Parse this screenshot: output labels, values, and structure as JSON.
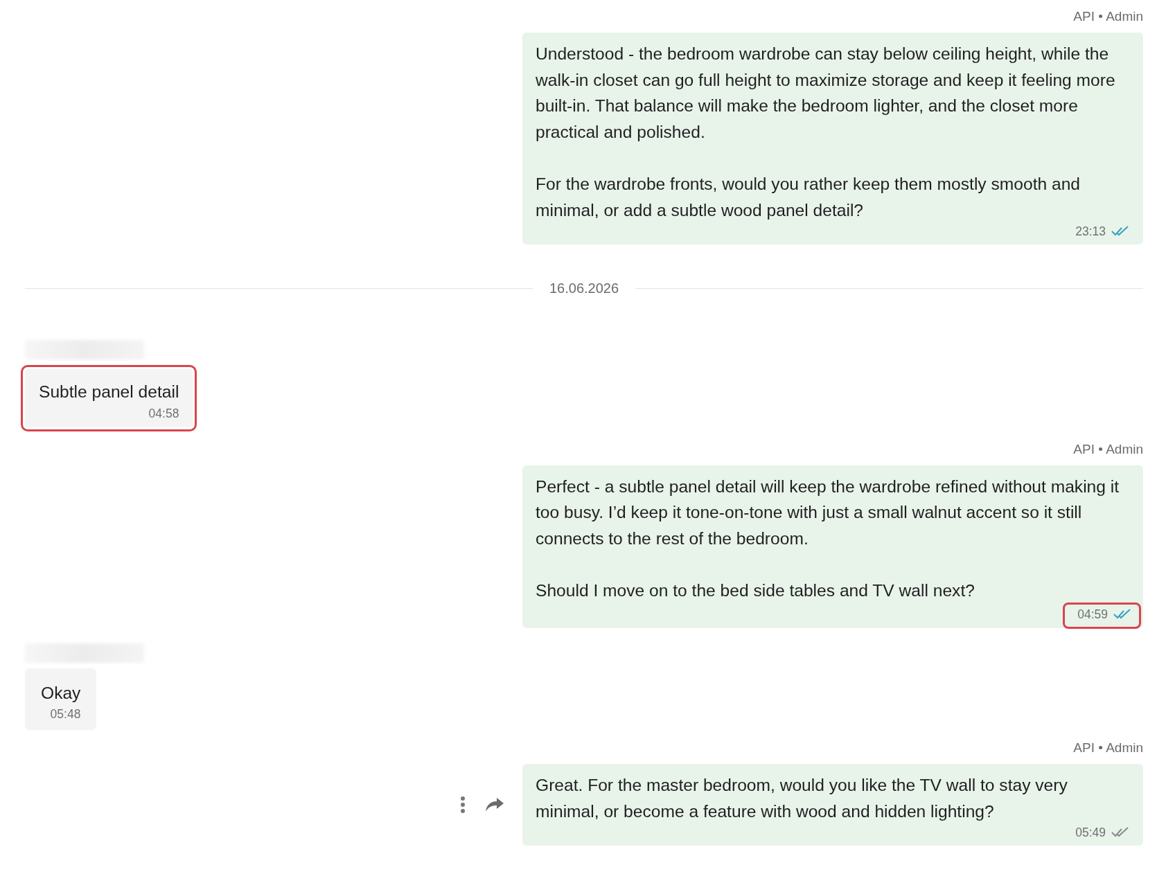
{
  "messages": [
    {
      "kind": "outgoing",
      "sender": "API • Admin",
      "paragraphs": [
        "Understood - the bedroom wardrobe can stay below ceiling height, while the walk-in closet can go full height to maximize storage and keep it feeling more built-in. That balance will make the bedroom lighter, and the closet more practical and polished.",
        "For the wardrobe fronts, would you rather keep them mostly smooth and minimal, or add a subtle wood panel detail?"
      ],
      "time": "23:13",
      "read": true,
      "highlighted": false,
      "actions_visible": false
    },
    {
      "kind": "date",
      "label": "16.06.2026"
    },
    {
      "kind": "incoming",
      "paragraphs": [
        "Subtle panel detail"
      ],
      "time": "04:58",
      "highlighted": true
    },
    {
      "kind": "outgoing",
      "sender": "API • Admin",
      "paragraphs": [
        "Perfect - a subtle panel detail will keep the wardrobe refined without making it too busy. I’d keep it tone-on-tone with just a small walnut accent so it still connects to the rest of the bedroom.",
        "Should I move on to the bed side tables and TV wall next?"
      ],
      "time": "04:59",
      "read": true,
      "highlighted": true,
      "actions_visible": false
    },
    {
      "kind": "incoming",
      "paragraphs": [
        "Okay"
      ],
      "time": "05:48",
      "highlighted": false
    },
    {
      "kind": "outgoing",
      "sender": "API • Admin",
      "paragraphs": [
        "Great. For the master bedroom, would you like the TV wall to stay very minimal, or become a feature with wood and hidden lighting?"
      ],
      "time": "05:49",
      "read": false,
      "highlighted": false,
      "actions_visible": true
    }
  ]
}
